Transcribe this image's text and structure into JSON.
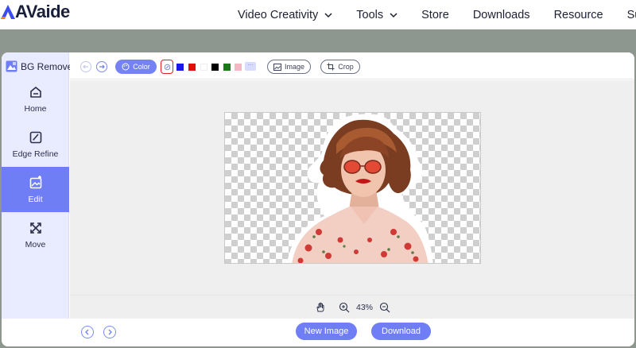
{
  "site": {
    "logo_text": "AVaide",
    "nav": [
      {
        "label": "Video Creativity",
        "has_dropdown": true
      },
      {
        "label": "Tools",
        "has_dropdown": true
      },
      {
        "label": "Store",
        "has_dropdown": false
      },
      {
        "label": "Downloads",
        "has_dropdown": false
      },
      {
        "label": "Resource",
        "has_dropdown": false
      },
      {
        "label": "Support",
        "has_dropdown": false
      }
    ]
  },
  "app": {
    "title": "BG Remover",
    "sidebar": [
      {
        "label": "Home",
        "icon": "home-icon",
        "active": false
      },
      {
        "label": "Edge Refine",
        "icon": "edge-refine-icon",
        "active": false
      },
      {
        "label": "Edit",
        "icon": "edit-icon",
        "active": true
      },
      {
        "label": "Move",
        "icon": "move-icon",
        "active": false
      }
    ],
    "toolbar": {
      "color_label": "Color",
      "swatches": [
        "#1a1ae6",
        "#e01010",
        "#ffffff",
        "#000000",
        "#1a7a1a",
        "#f4b8c4"
      ],
      "image_label": "Image",
      "crop_label": "Crop"
    },
    "zoom": {
      "value": "43%"
    },
    "footer": {
      "new_image_label": "New Image",
      "download_label": "Download"
    },
    "colors": {
      "accent": "#6f7ef5",
      "sidebar_bg": "#e9ecff",
      "picker_border": "#e02020"
    }
  }
}
